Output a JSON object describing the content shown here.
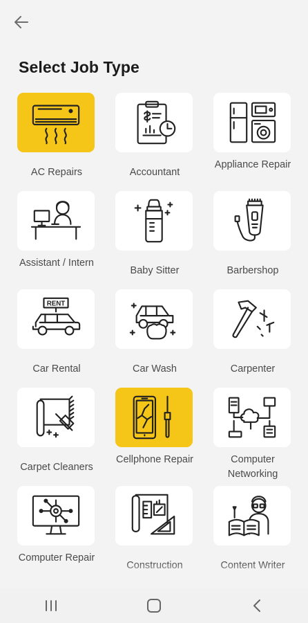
{
  "header": {
    "back_icon": "arrow-left-icon",
    "title": "Select Job Type"
  },
  "colors": {
    "background": "#f3f3f3",
    "tile": "#ffffff",
    "selected_tile": "#f5c518",
    "icon_stroke": "#222222"
  },
  "job_types": [
    {
      "label": "AC Repairs",
      "icon": "air-conditioner-icon",
      "selected": true
    },
    {
      "label": "Accountant",
      "icon": "clipboard-dollar-icon",
      "selected": false
    },
    {
      "label": "Appliance Repair",
      "icon": "fridge-washer-icon",
      "selected": false
    },
    {
      "label": "Assistant / Intern",
      "icon": "person-desk-icon",
      "selected": false
    },
    {
      "label": "Baby Sitter",
      "icon": "baby-bottle-icon",
      "selected": false
    },
    {
      "label": "Barbershop",
      "icon": "hair-clipper-icon",
      "selected": false
    },
    {
      "label": "Car Rental",
      "icon": "rent-car-icon",
      "selected": false
    },
    {
      "label": "Car Wash",
      "icon": "car-wash-icon",
      "selected": false
    },
    {
      "label": "Carpenter",
      "icon": "hammer-nails-icon",
      "selected": false
    },
    {
      "label": "Carpet Cleaners",
      "icon": "carpet-brush-icon",
      "selected": false
    },
    {
      "label": "Cellphone Repair",
      "icon": "broken-phone-screwdriver-icon",
      "selected": true
    },
    {
      "label": "Computer Networking",
      "icon": "cloud-network-icon",
      "selected": false
    },
    {
      "label": "Computer Repair",
      "icon": "monitor-circuit-icon",
      "selected": false
    },
    {
      "label": "Construction",
      "icon": "blueprint-ruler-icon",
      "selected": false
    },
    {
      "label": "Content Writer",
      "icon": "writer-book-icon",
      "selected": false
    }
  ],
  "nav_bar": {
    "recents": "recents-icon",
    "home": "home-icon",
    "back": "back-chevron-icon"
  }
}
